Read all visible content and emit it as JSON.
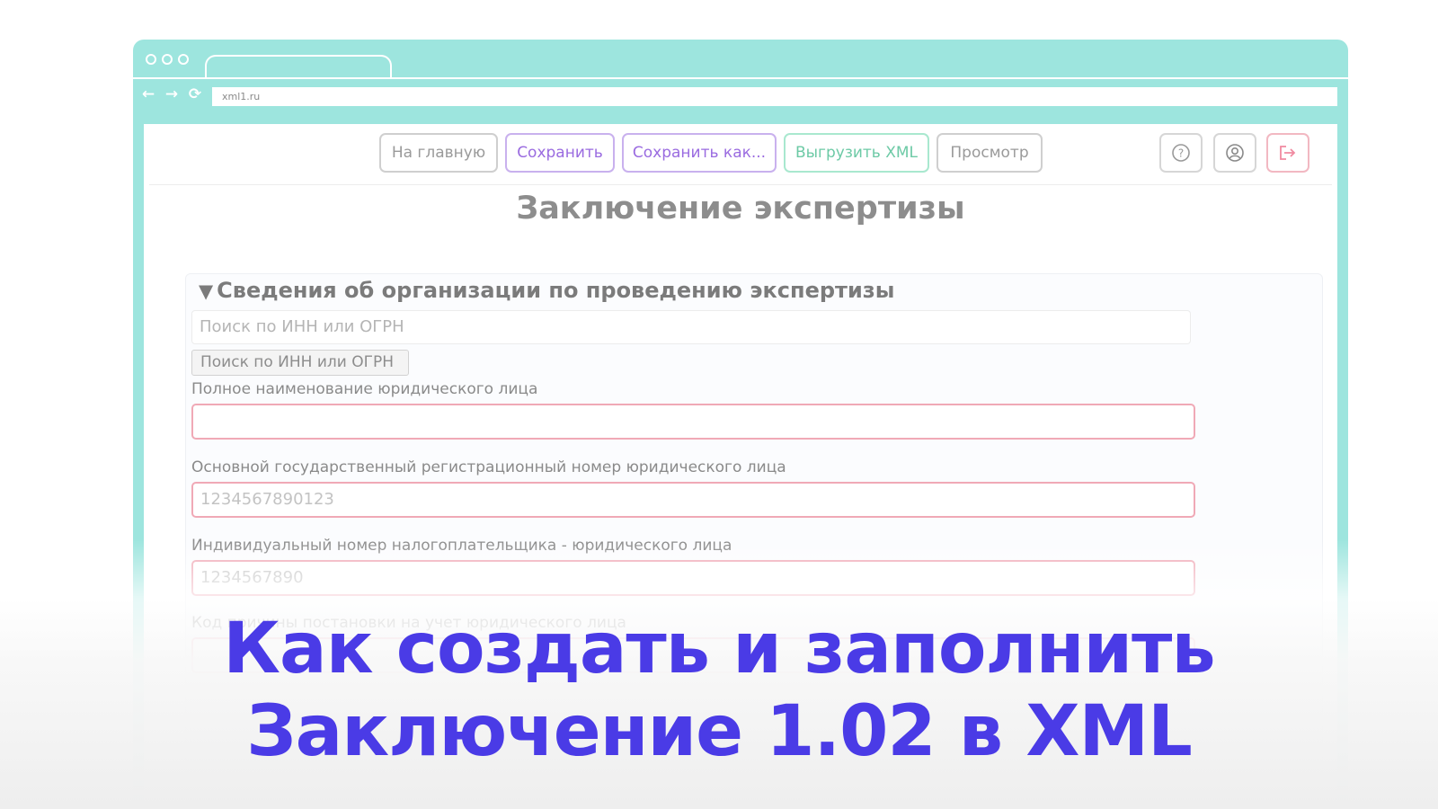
{
  "browser": {
    "address": "xml1.ru",
    "nav_icons": [
      "←",
      "→",
      "⟳"
    ]
  },
  "toolbar": {
    "buttons": [
      {
        "label": "На главную",
        "color": "#9a9a9a"
      },
      {
        "label": "Сохранить",
        "color": "#9a6be0"
      },
      {
        "label": "Сохранить как...",
        "color": "#9a6be0"
      },
      {
        "label": "Выгрузить XML",
        "color": "#6dcaa6"
      },
      {
        "label": "Просмотр",
        "color": "#9a9a9a"
      }
    ],
    "icons": [
      "help-icon",
      "user-icon",
      "logout-icon"
    ]
  },
  "page": {
    "title": "Заключение экспертизы"
  },
  "section": {
    "title": "Сведения об организации по проведению экспертизы",
    "search_placeholder": "Поиск по ИНН или ОГРН",
    "search_button": "Поиск по ИНН или ОГРН",
    "fields": [
      {
        "label": "Полное наименование юридического лица",
        "value": ""
      },
      {
        "label": "Основной государственный регистрационный номер юридического лица",
        "value": "1234567890123"
      },
      {
        "label": "Индивидуальный номер налогоплательщика - юридического лица",
        "value": "1234567890"
      },
      {
        "label": "Код причины постановки на учет юридического лица",
        "value": ""
      }
    ]
  },
  "overlay": {
    "line1": "Как создать и заполнить",
    "line2": "Заключение 1.02 в XML",
    "color": "#4a3be6"
  }
}
